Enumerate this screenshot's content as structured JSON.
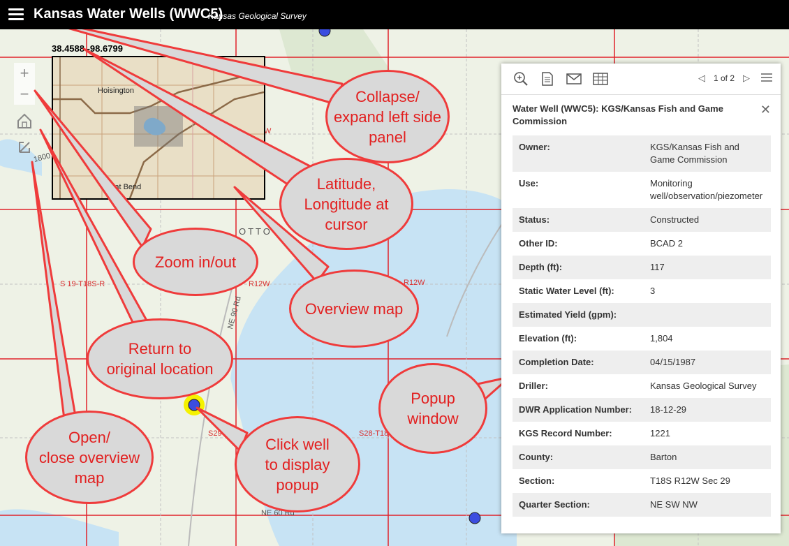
{
  "header": {
    "title": "Kansas Water Wells (WWC5)",
    "subtitle": "Kansas Geological Survey"
  },
  "map": {
    "coordinates": "38.4588 -98.6799",
    "overview": {
      "town_top": "Hoisington",
      "town_bottom": "Great Bend"
    },
    "section_labels": [
      "S 19-T18S-R",
      "R12W",
      "R12W",
      "S29-",
      "S28-T18",
      "W"
    ],
    "road_labels": [
      "NE 90 Rd",
      "NE 60 Rd",
      "1800"
    ],
    "place_label": "OTTO"
  },
  "popup": {
    "pager_text": "1 of 2",
    "title": "Water Well (WWC5): KGS/Kansas Fish and Game Commission",
    "rows": [
      {
        "label": "Owner:",
        "value": "KGS/Kansas Fish and Game Commission"
      },
      {
        "label": "Use:",
        "value": "Monitoring well/observation/piezometer"
      },
      {
        "label": "Status:",
        "value": "Constructed"
      },
      {
        "label": "Other ID:",
        "value": "BCAD 2"
      },
      {
        "label": "Depth (ft):",
        "value": "117"
      },
      {
        "label": "Static Water Level (ft):",
        "value": "3"
      },
      {
        "label": "Estimated Yield (gpm):",
        "value": ""
      },
      {
        "label": "Elevation (ft):",
        "value": "1,804"
      },
      {
        "label": "Completion Date:",
        "value": "04/15/1987"
      },
      {
        "label": "Driller:",
        "value": "Kansas Geological Survey"
      },
      {
        "label": "DWR Application Number:",
        "value": "18-12-29"
      },
      {
        "label": "KGS Record Number:",
        "value": "1221"
      },
      {
        "label": "County:",
        "value": "Barton"
      },
      {
        "label": "Section:",
        "value": "T18S  R12W  Sec 29"
      },
      {
        "label": "Quarter Section:",
        "value": "NE  SW  NW"
      }
    ]
  },
  "callouts": {
    "collapse": [
      "Collapse/",
      "expand left side",
      "panel"
    ],
    "latlong": [
      "Latitude,",
      "Longitude at",
      "cursor"
    ],
    "zoom": [
      "Zoom in/out"
    ],
    "overview": [
      "Overview map"
    ],
    "return": [
      "Return to",
      "original location"
    ],
    "popup": [
      "Popup",
      "window"
    ],
    "open_close": [
      "Open/",
      "close overview",
      "map"
    ],
    "click_well": [
      "Click well",
      "to display",
      "popup"
    ]
  },
  "colors": {
    "callout_stroke": "#ef3b3b",
    "callout_fill": "#d9d9d9",
    "section_line": "#d93030",
    "water": "#c7e3f4",
    "well_marker": "#3b4de0",
    "well_highlight": "#f5f200"
  }
}
